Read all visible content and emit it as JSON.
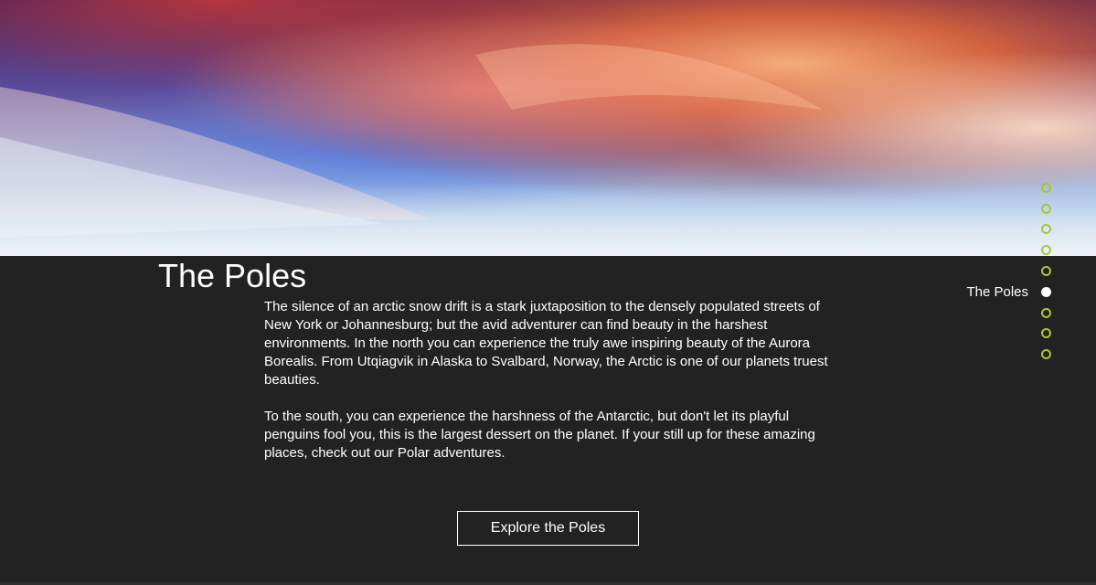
{
  "section": {
    "title": "The Poles",
    "paragraphs": [
      "The silence of an arctic snow drift is a stark juxtaposition to the densely populated streets of New York or Johannesburg; but the avid adventurer can find beauty in the harshest environments. In the north you can experience the truly awe inspiring beauty of the Aurora Borealis. From Utqiagvik in Alaska to Svalbard, Norway, the Arctic is one of our planets truest beauties.",
      "To the south, you can experience the harshness of the Antarctic, but don't let its playful penguins fool you, this is the largest dessert on the planet. If your still up for these amazing places, check out our Polar adventures."
    ],
    "cta_label": "Explore the Poles"
  },
  "nav": {
    "active_label": "The Poles",
    "dot_count": 9,
    "active_index": 5
  },
  "colors": {
    "background": "#222222",
    "accent": "#a8c636",
    "text": "#ffffff"
  }
}
